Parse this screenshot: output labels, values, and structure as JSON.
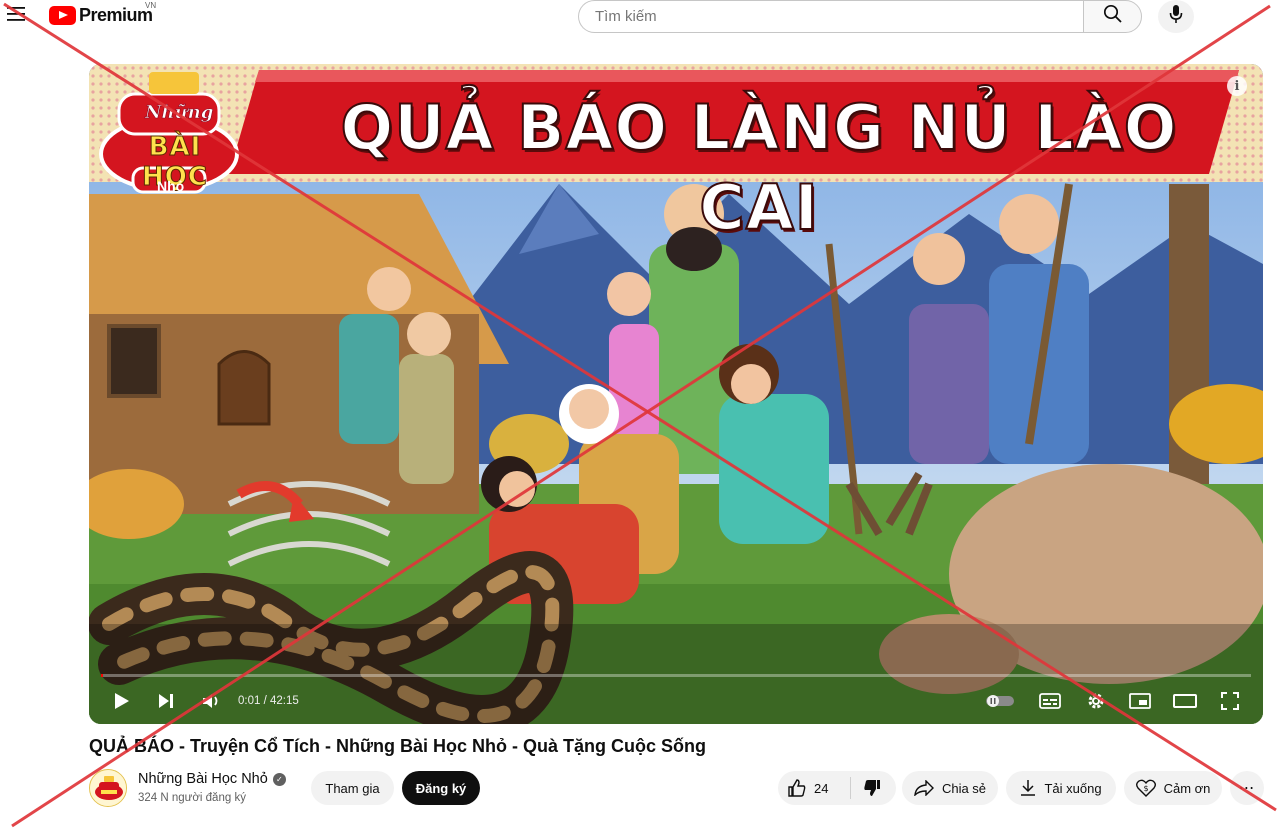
{
  "header": {
    "logo_text": "Premium",
    "region": "VN",
    "search_placeholder": "Tìm kiếm"
  },
  "player": {
    "banner_title": "QUẢ BÁO LÀNG NỦ LÀO CAI",
    "badge": {
      "line1": "Những",
      "line2": "BÀI HỌC",
      "line3": "Nhỏ"
    },
    "time": "0:01 / 42:15",
    "progress_fraction": 0.0004,
    "info_label": "i"
  },
  "video": {
    "title": "QUẢ BÁO - Truyện Cổ Tích - Những Bài Học Nhỏ - Quà Tặng Cuộc Sống",
    "channel": "Những Bài Học Nhỏ",
    "subscribers": "324 N người đăng ký",
    "join_label": "Tham gia",
    "subscribe_label": "Đăng ký",
    "likes": "24",
    "share_label": "Chia sẻ",
    "download_label": "Tải xuống",
    "thanks_label": "Cảm ơn"
  },
  "icons": {
    "menu": "menu-icon",
    "search": "search-icon",
    "mic": "mic-icon",
    "play": "play-icon",
    "next": "next-icon",
    "volume": "volume-icon",
    "autoplay": "autoplay-toggle-icon",
    "subtitles": "subtitles-icon",
    "settings": "settings-gear-icon",
    "miniplayer": "miniplayer-icon",
    "theater": "theater-mode-icon",
    "fullscreen": "fullscreen-icon",
    "like": "thumbs-up-icon",
    "dislike": "thumbs-down-icon",
    "share": "share-arrow-icon",
    "download": "download-icon",
    "thanks": "heart-dollar-icon",
    "more": "more-horizontal-icon"
  },
  "colors": {
    "brand_red": "#ff0000",
    "overlay_cross": "#e0363a",
    "banner_red": "#d4151f"
  }
}
